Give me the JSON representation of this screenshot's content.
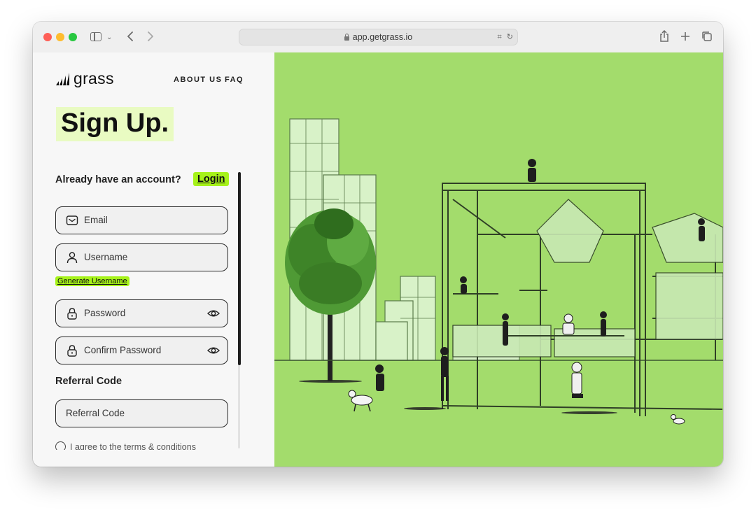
{
  "browser": {
    "url": "app.getgrass.io"
  },
  "header": {
    "logo_text": "grass",
    "nav": [
      "ABOUT US",
      "FAQ"
    ]
  },
  "form": {
    "title": "Sign Up.",
    "already_text": "Already have an account?",
    "login_label": "Login",
    "email_placeholder": "Email",
    "username_placeholder": "Username",
    "generate_username_label": "Generate Username",
    "password_placeholder": "Password",
    "confirm_password_placeholder": "Confirm Password",
    "referral_title": "Referral Code",
    "referral_placeholder": "Referral Code",
    "terms_text": "I agree to the terms & conditions"
  },
  "colors": {
    "accent": "#a6f21a",
    "title_highlight": "#e9fbc2",
    "illustration_bg": "#a3dc6c"
  },
  "icons": [
    "sidebar-icon",
    "chevron-down-icon",
    "back-icon",
    "forward-icon",
    "lock-icon",
    "translate-icon",
    "reload-icon",
    "share-icon",
    "plus-icon",
    "tabs-icon",
    "mail-icon",
    "user-icon",
    "padlock-icon",
    "eye-icon"
  ]
}
